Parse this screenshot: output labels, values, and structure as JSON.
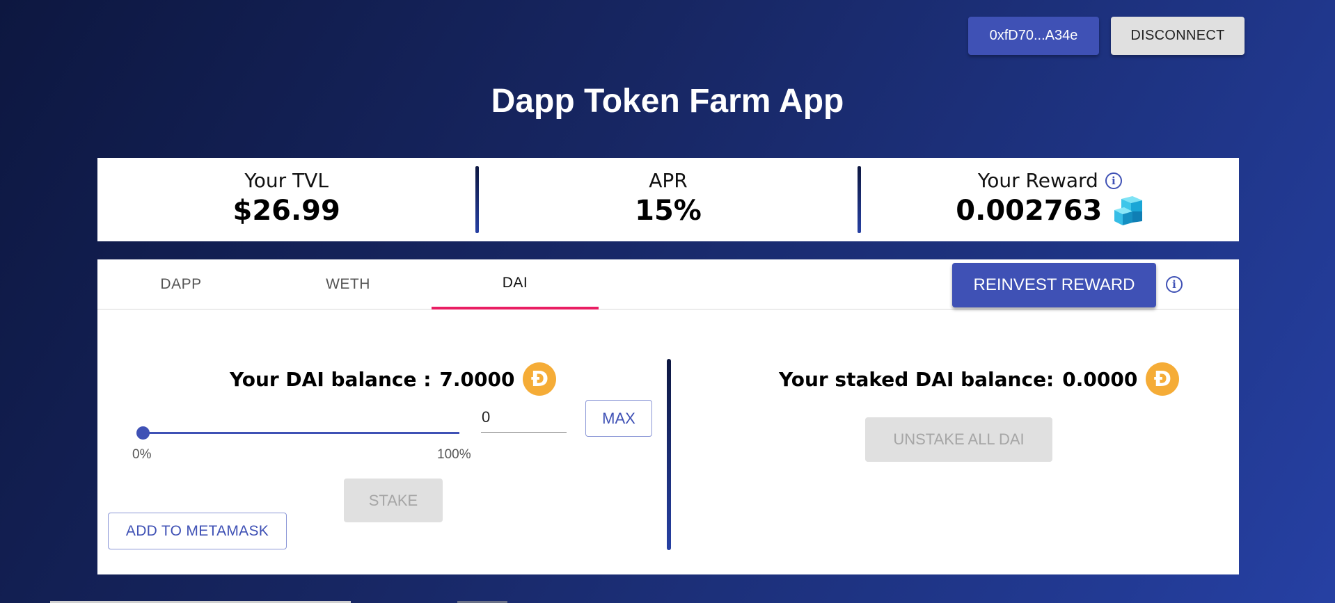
{
  "header": {
    "wallet_address": "0xfD70...A34e",
    "disconnect_label": "DISCONNECT",
    "title": "Dapp Token Farm App"
  },
  "stats": {
    "tvl_label": "Your TVL",
    "tvl_value": "$26.99",
    "apr_label": "APR",
    "apr_value": "15%",
    "reward_label": "Your Reward",
    "reward_value": "0.002763"
  },
  "tabs": [
    {
      "label": "DAPP",
      "active": false
    },
    {
      "label": "WETH",
      "active": false
    },
    {
      "label": "DAI",
      "active": true
    }
  ],
  "reinvest_label": "REINVEST REWARD",
  "stake_panel": {
    "balance_label": "Your DAI balance :",
    "balance_value": "7.0000",
    "slider_value_percent": 0,
    "slider_min_label": "0%",
    "slider_max_label": "100%",
    "amount_value": "0",
    "max_label": "MAX",
    "stake_label": "STAKE",
    "metamask_label": "ADD TO METAMASK"
  },
  "unstake_panel": {
    "balance_label": "Your staked DAI balance:",
    "balance_value": "0.0000",
    "unstake_label": "UNSTAKE ALL DAI"
  },
  "colors": {
    "primary": "#3f51b5",
    "tab_indicator": "#e91e63",
    "dai_coin": "#f5ac37"
  },
  "icons": {
    "dai": "dai-coin-icon",
    "dapp_token": "dapp-token-cube-icon",
    "info": "info-icon"
  }
}
